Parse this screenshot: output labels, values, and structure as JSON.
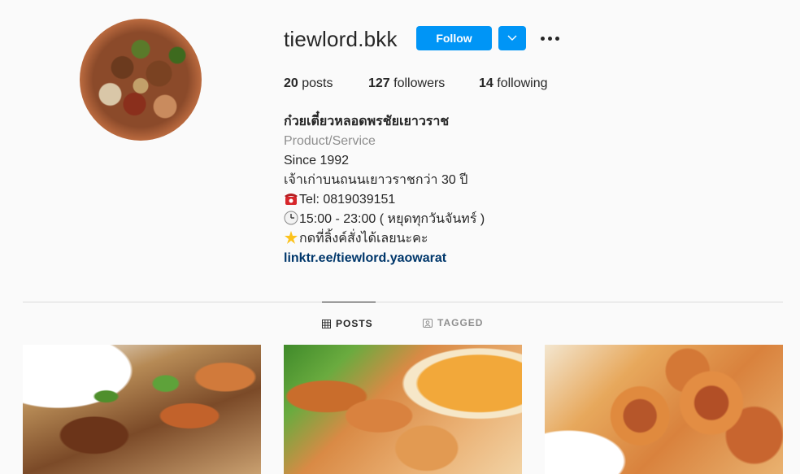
{
  "profile": {
    "username": "tiewlord.bkk",
    "follow_label": "Follow",
    "stats": {
      "posts_count": "20",
      "posts_label": "posts",
      "followers_count": "127",
      "followers_label": "followers",
      "following_count": "14",
      "following_label": "following"
    },
    "bio": {
      "name": "ก๋วยเตี๋ยวหลอดพรชัยเยาวราช",
      "category": "Product/Service",
      "line1": "Since 1992",
      "line2": "เจ้าเก่าบนถนนเยาวราชกว่า 30 ปี",
      "line3": "Tel: 0819039151",
      "line4": "15:00 - 23:00 ( หยุดทุกวันจันทร์ )",
      "line5": "กดที่ลิ้งค์สั่งได้เลยนะคะ",
      "link": "linktr.ee/tiewlord.yaowarat"
    }
  },
  "tabs": [
    {
      "label": "POSTS",
      "icon": "grid-icon",
      "active": true
    },
    {
      "label": "TAGGED",
      "icon": "tagged-icon",
      "active": false
    }
  ],
  "colors": {
    "accent": "#0095f6",
    "text": "#262626",
    "secondary": "#8e8e8e",
    "link": "#00376b",
    "background": "#fafafa"
  }
}
